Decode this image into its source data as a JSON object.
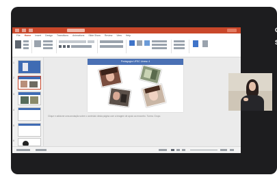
{
  "window": {
    "title": "",
    "ribbon_tabs": [
      "File",
      "Home",
      "Insert",
      "Design",
      "Transitions",
      "Animations",
      "Slide Show",
      "Review",
      "View",
      "Help"
    ],
    "active_tab": "Home"
  },
  "slide": {
    "header": "Pedagogia UFSC Unesc 4"
  },
  "notes": {
    "text": "Clique e adicione uma anotação sobre o conteúdo desta página com a imagem de apoio ao encontro. Turma. Grupo."
  },
  "side_labels": [
    "C",
    "S"
  ],
  "thumbnails": [
    "1",
    "2",
    "3",
    "4",
    "5",
    "6"
  ],
  "colors": {
    "accent": "#c9472a",
    "slide_header": "#4a70b4",
    "frame": "#1d1d1f"
  }
}
